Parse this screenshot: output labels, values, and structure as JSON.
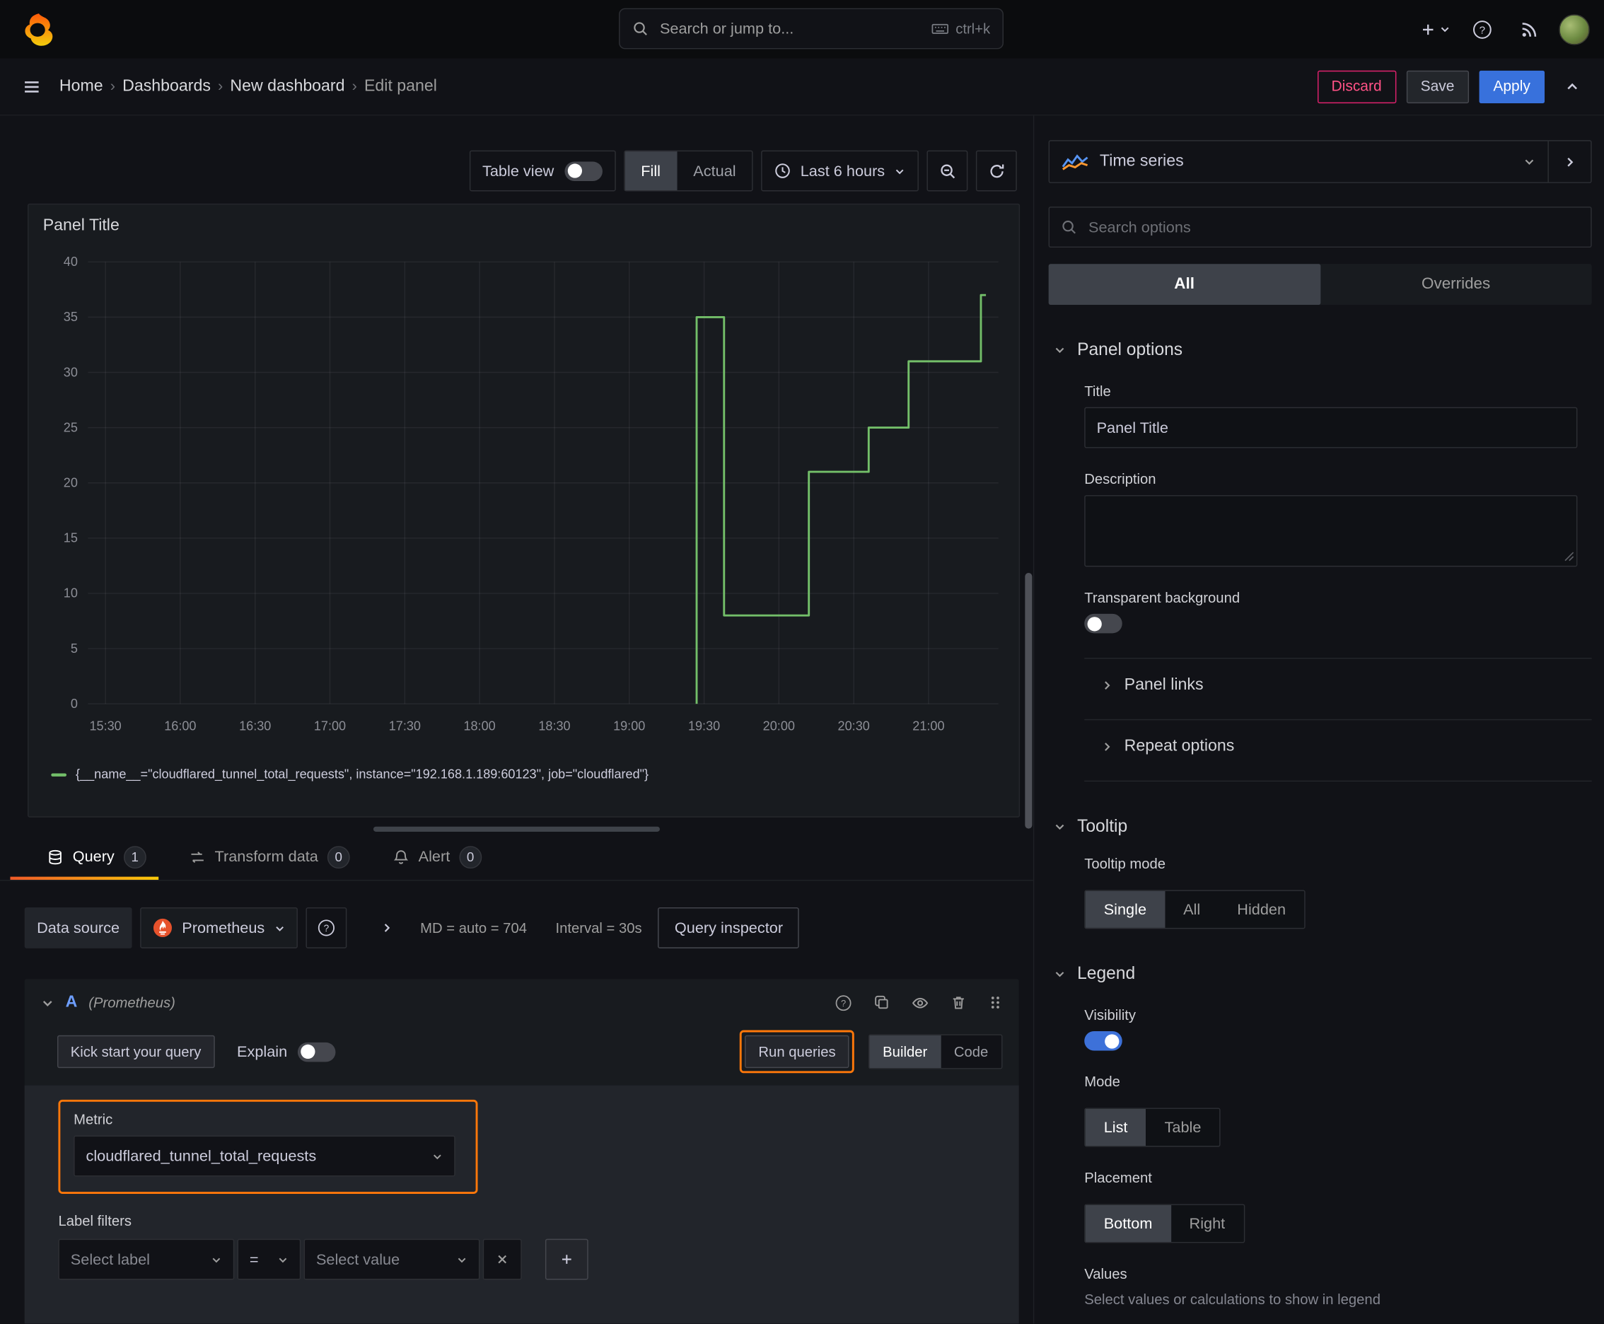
{
  "colors": {
    "accent_orange": "#ff780a",
    "primary_blue": "#3871dc",
    "series_green": "#73bf69",
    "destructive_red": "#e0226e",
    "toggle_on_blue": "#3d71d9"
  },
  "topbar": {
    "search_placeholder": "Search or jump to...",
    "search_shortcut": "ctrl+k"
  },
  "breadcrumb": {
    "items": [
      "Home",
      "Dashboards",
      "New dashboard",
      "Edit panel"
    ]
  },
  "actions": {
    "discard": "Discard",
    "save": "Save",
    "apply": "Apply"
  },
  "toolbar": {
    "table_view_label": "Table view",
    "fill_label": "Fill",
    "actual_label": "Actual",
    "time_range_label": "Last 6 hours"
  },
  "panel": {
    "title": "Panel Title"
  },
  "chart_data": {
    "type": "line",
    "title": "Panel Title",
    "x_unit": "minutes after 15:30",
    "x_range": [
      -7,
      358
    ],
    "ylim": [
      0,
      40
    ],
    "yticks": [
      0,
      5,
      10,
      15,
      20,
      25,
      30,
      35,
      40
    ],
    "xticks": [
      "15:30",
      "16:00",
      "16:30",
      "17:00",
      "17:30",
      "18:00",
      "18:30",
      "19:00",
      "19:30",
      "20:00",
      "20:30",
      "21:00"
    ],
    "xtick_minutes": [
      0,
      30,
      60,
      90,
      120,
      150,
      180,
      210,
      240,
      270,
      300,
      330
    ],
    "grid": true,
    "legend_position": "bottom",
    "series": [
      {
        "name": "{__name__=\"cloudflared_tunnel_total_requests\", instance=\"192.168.1.189:60123\", job=\"cloudflared\"}",
        "color": "#73bf69",
        "points_minutes_value": [
          [
            237,
            0
          ],
          [
            237,
            35
          ],
          [
            248,
            35
          ],
          [
            248,
            8
          ],
          [
            282,
            8
          ],
          [
            282,
            21
          ],
          [
            306,
            21
          ],
          [
            306,
            25
          ],
          [
            322,
            25
          ],
          [
            322,
            31
          ],
          [
            351,
            31
          ],
          [
            351,
            37
          ],
          [
            353,
            37
          ]
        ]
      }
    ]
  },
  "tabs": {
    "query_label": "Query",
    "query_count": "1",
    "transform_label": "Transform data",
    "transform_count": "0",
    "alert_label": "Alert",
    "alert_count": "0"
  },
  "query": {
    "datasource_label": "Data source",
    "datasource_name": "Prometheus",
    "stats_md": "MD = auto = 704",
    "stats_interval": "Interval = 30s",
    "inspector_label": "Query inspector",
    "ref_id": "A",
    "ref_ds": "(Prometheus)",
    "kickstart_label": "Kick start your query",
    "explain_label": "Explain",
    "run_label": "Run queries",
    "builder_label": "Builder",
    "code_label": "Code",
    "metric_label": "Metric",
    "metric_value": "cloudflared_tunnel_total_requests",
    "label_filters_label": "Label filters",
    "select_label_placeholder": "Select label",
    "operator_value": "=",
    "select_value_placeholder": "Select value"
  },
  "options": {
    "viz_name": "Time series",
    "search_placeholder": "Search options",
    "tab_all": "All",
    "tab_overrides": "Overrides",
    "panel_options_header": "Panel options",
    "title_label": "Title",
    "title_value": "Panel Title",
    "description_label": "Description",
    "transparent_bg_label": "Transparent background",
    "panel_links_label": "Panel links",
    "repeat_options_label": "Repeat options",
    "tooltip_header": "Tooltip",
    "tooltip_mode_label": "Tooltip mode",
    "tooltip_single": "Single",
    "tooltip_all": "All",
    "tooltip_hidden": "Hidden",
    "legend_header": "Legend",
    "visibility_label": "Visibility",
    "mode_label": "Mode",
    "mode_list": "List",
    "mode_table": "Table",
    "placement_label": "Placement",
    "placement_bottom": "Bottom",
    "placement_right": "Right",
    "values_label": "Values",
    "values_help": "Select values or calculations to show in legend"
  }
}
